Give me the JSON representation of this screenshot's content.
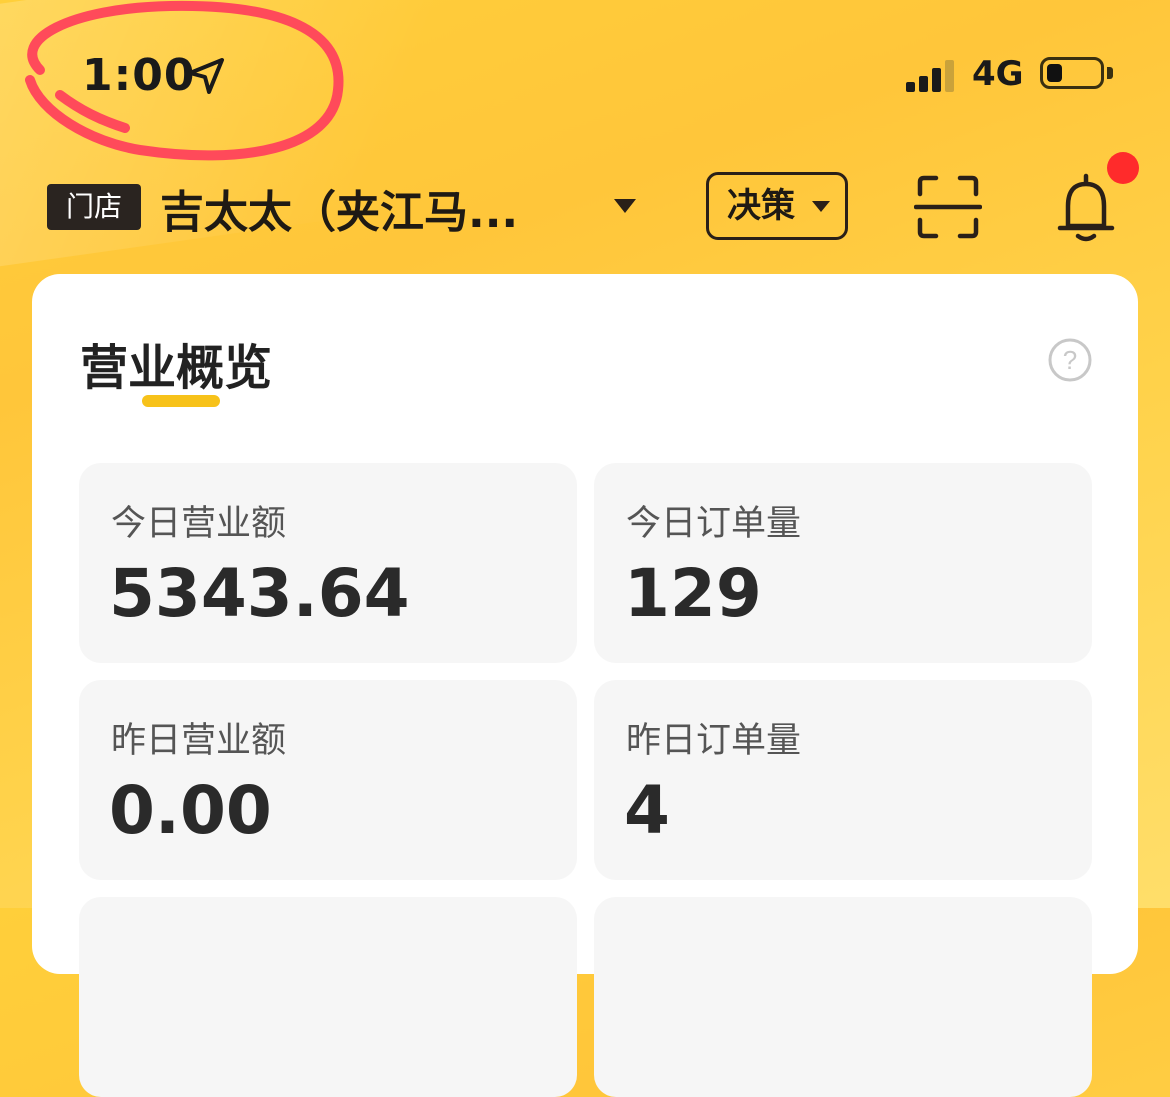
{
  "status_bar": {
    "time": "1:00",
    "network": "4G",
    "battery_level": 0.3,
    "signal_bars_active": 3
  },
  "header": {
    "store_badge": "门店",
    "store_name": "吉太太（夹江马...",
    "decision_button": "决策"
  },
  "overview": {
    "title": "营业概览",
    "metrics": [
      {
        "label": "今日营业额",
        "value": "5343.64"
      },
      {
        "label": "今日订单量",
        "value": "129"
      },
      {
        "label": "昨日营业额",
        "value": "0.00"
      },
      {
        "label": "昨日订单量",
        "value": "4"
      }
    ]
  },
  "colors": {
    "background": "#ffc63a",
    "accent": "#f7c21a",
    "notification_dot": "#ff2b2b",
    "annotation_circle": "#ff4a5a"
  },
  "icons": [
    "location-arrow-icon",
    "signal-icon",
    "battery-icon",
    "dropdown-caret-icon",
    "scan-icon",
    "bell-icon",
    "help-icon"
  ]
}
